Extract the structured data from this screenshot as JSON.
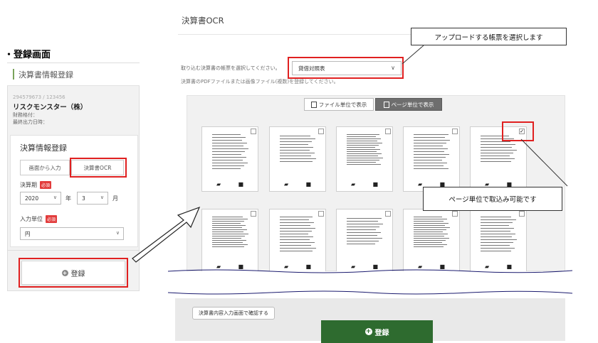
{
  "left": {
    "section_title": "・登録画面",
    "panel_title": "決算書情報登録",
    "company_id": "294579673 / 123456",
    "company_name": "リスクモンスター（株）",
    "rating_label": "財務格付：",
    "last_output_label": "最終出力日時：",
    "card_title": "決算情報登録",
    "tab_manual": "画面から入力",
    "tab_ocr": "決算書OCR",
    "period_label": "決算期",
    "required_badge": "必須",
    "year_value": "2020",
    "year_unit": "年",
    "month_value": "3",
    "month_unit": "月",
    "unit_label": "入力単位",
    "unit_value": "円",
    "register_button": "登録"
  },
  "right": {
    "title": "決算書OCR",
    "instruction_select": "取り込む決算書の帳票を選択してください。",
    "doc_select_value": "貸借対照表",
    "instruction_file": "決算書のPDFファイルまたは画像ファイル(複数)を登録してください。",
    "view_file": "ファイル単位で表示",
    "view_page": "ページ単位で表示",
    "confirm_button": "決算書内容入力画面で確認する",
    "register_button": "登録"
  },
  "callouts": {
    "select_doc": "アップロードする帳票を選択します",
    "page_import": "ページ単位で取込み可能です"
  },
  "thumbnails": [
    {
      "checked": false
    },
    {
      "checked": false
    },
    {
      "checked": false
    },
    {
      "checked": false
    },
    {
      "checked": true
    },
    {
      "checked": false
    },
    {
      "checked": false
    },
    {
      "checked": false
    },
    {
      "checked": false
    },
    {
      "checked": false
    }
  ],
  "colors": {
    "highlight_red": "#e02020",
    "accent_green": "#2e6b2f",
    "required_red": "#e23c3c",
    "panel_gray": "#f2f2f2"
  }
}
